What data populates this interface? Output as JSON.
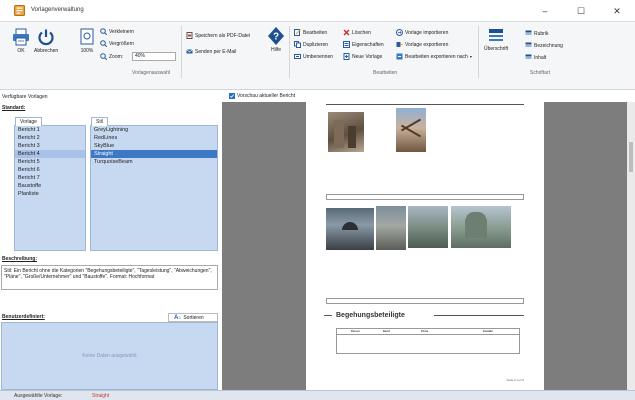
{
  "window": {
    "title": "Vorlagenverwaltung",
    "controls": [
      "–",
      "☐",
      "✕"
    ]
  },
  "ribbon": {
    "ok_label": "OK",
    "cancel_label": "Abbrechen",
    "zoom_100_label": "100%",
    "zoom_out_label": "Verkleinern",
    "zoom_in_label": "Vergrößern",
    "zoom_label": "Zoom:",
    "zoom_value": "40%",
    "group_preview": "Vorlagenauswahl",
    "save_pdf_label": "Speichern als PDF-Datei",
    "send_email_label": "Senden per E-Mail",
    "help_label": "Hilfe",
    "edit_label": "Bearbeiten",
    "duplicate_label": "Duplizieren",
    "rename_label": "Umbenennen",
    "delete_label": "Löschen",
    "properties_label": "Eigenschaften",
    "new_template_label": "Neue Vorlage",
    "import_label": "Vorlage importieren",
    "export_label": "Vorlage exportieren",
    "export_all_label": "Bearbeiten exportieren nach",
    "group_edit": "Bearbeiten",
    "heading_label": "Überschrift",
    "rubric_label": "Rubrik",
    "designation_label": "Bezeichnung",
    "content_label": "Inhalt",
    "group_font": "Schriftart"
  },
  "left": {
    "available_label": "Verfügbare Vorlagen",
    "standard_label": "Standard:",
    "templates_tab": "Vorlage",
    "templates": [
      "Bericht 1",
      "Bericht 2",
      "Bericht 3",
      "Bericht 4",
      "Bericht 5",
      "Bericht 6",
      "Bericht 7",
      "Baustoffe",
      "Planliste"
    ],
    "styles_tab": "Stil",
    "styles": [
      "GreyLightning",
      "RedLines",
      "SkyBlue",
      "Straight",
      "TurquoiseBeam"
    ],
    "description_label": "Beschreibung:",
    "description_text": "Stil: Ein Bericht ohne die Kategorien \"Begehungsbeteiligte\", \"Tagesleistung\", \"Abweichungen\", \"Pläne\", \"Große/Unternehmer\" und \"Baustoffe\". Format: Hochformat",
    "custom_label": "Benutzerdefiniert:",
    "sort_label": "Sortieren",
    "no_data": "Keine Daten ausgewählt"
  },
  "preview": {
    "checkbox_label": "Vorschau aktueller Bericht",
    "section_title": "Begehungsbeteiligte",
    "table_headers": [
      "Person",
      "Beruf",
      "Firma",
      "Kontakt"
    ],
    "page_number": "Seite 2 von 5"
  },
  "status": {
    "selected_label": "Ausgewählte Vorlage:",
    "selected_value": "Straight"
  },
  "colors": {
    "accent": "#3c78c4",
    "list_bg": "#c7d9f1",
    "preview_bg": "#7d7d7d"
  }
}
